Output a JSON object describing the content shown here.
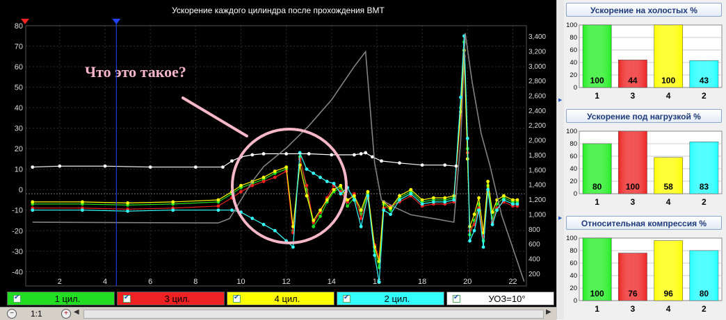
{
  "main": {
    "title": "Ускорение каждого цилиндра после прохождения ВМТ",
    "annotation": "Что это такое?"
  },
  "chart_data": {
    "type": "line",
    "xlim": [
      0.5,
      22.6
    ],
    "ylim": [
      -47,
      80
    ],
    "y2lim": [
      40,
      3550
    ],
    "x_ticks": [
      2,
      4,
      6,
      8,
      10,
      12,
      14,
      16,
      18,
      20,
      22
    ],
    "y_ticks": [
      -40,
      -30,
      -20,
      -10,
      0,
      10,
      20,
      30,
      40,
      50,
      60,
      70,
      80
    ],
    "y2_ticks": [
      "200",
      "400",
      "600",
      "800",
      "1,000",
      "1,200",
      "1,400",
      "1,600",
      "1,800",
      "2,000",
      "2,200",
      "2,400",
      "2,600",
      "2,800",
      "3,000",
      "3,200",
      "3,400"
    ],
    "y2_tick_values": [
      200,
      400,
      600,
      800,
      1000,
      1200,
      1400,
      1600,
      1800,
      2000,
      2200,
      2400,
      2600,
      2800,
      3000,
      3200,
      3400
    ],
    "cursor_x": 4.5,
    "grid": true,
    "series": [
      {
        "name": "1 цил.",
        "color": "#22dd22",
        "points": [
          [
            0.8,
            -7
          ],
          [
            3,
            -7
          ],
          [
            5,
            -7.5
          ],
          [
            7,
            -7
          ],
          [
            9,
            -6
          ],
          [
            9.6,
            -2
          ],
          [
            10,
            1
          ],
          [
            10.5,
            3
          ],
          [
            11,
            5
          ],
          [
            11.5,
            8
          ],
          [
            12,
            10
          ],
          [
            12.3,
            -20
          ],
          [
            12.6,
            16
          ],
          [
            12.9,
            0
          ],
          [
            13.2,
            -18
          ],
          [
            13.5,
            -13
          ],
          [
            13.8,
            -6
          ],
          [
            14.1,
            -1
          ],
          [
            14.4,
            1
          ],
          [
            14.7,
            -8
          ],
          [
            15,
            -4
          ],
          [
            15.3,
            -12
          ],
          [
            15.6,
            -2
          ],
          [
            15.9,
            -30
          ],
          [
            16.1,
            -38
          ],
          [
            16.3,
            -7
          ],
          [
            16.6,
            -10
          ],
          [
            17,
            -4
          ],
          [
            17.5,
            -1
          ],
          [
            18,
            -6
          ],
          [
            18.5,
            -5
          ],
          [
            19,
            -5
          ],
          [
            19.4,
            -4
          ],
          [
            19.7,
            40
          ],
          [
            19.85,
            72
          ],
          [
            20,
            20
          ],
          [
            20.1,
            -22
          ],
          [
            20.3,
            -15
          ],
          [
            20.5,
            -7
          ],
          [
            20.7,
            -25
          ],
          [
            20.9,
            2
          ],
          [
            21.1,
            -14
          ],
          [
            21.3,
            -7
          ],
          [
            21.6,
            -4
          ],
          [
            22,
            -6
          ],
          [
            22.2,
            -6
          ]
        ]
      },
      {
        "name": "3 цил.",
        "color": "#ee2222",
        "points": [
          [
            0.8,
            -9
          ],
          [
            3,
            -9
          ],
          [
            5,
            -9.5
          ],
          [
            7,
            -9
          ],
          [
            9,
            -8
          ],
          [
            9.6,
            -4
          ],
          [
            10,
            -1
          ],
          [
            10.5,
            2
          ],
          [
            11,
            4
          ],
          [
            11.5,
            6
          ],
          [
            12,
            9
          ],
          [
            12.3,
            -21
          ],
          [
            12.6,
            15
          ],
          [
            12.9,
            2
          ],
          [
            13.2,
            -16
          ],
          [
            13.5,
            -11
          ],
          [
            13.8,
            -4
          ],
          [
            14.1,
            2
          ],
          [
            14.4,
            -1
          ],
          [
            14.7,
            -6
          ],
          [
            15,
            -2
          ],
          [
            15.3,
            -14
          ],
          [
            15.6,
            -4
          ],
          [
            15.9,
            -27
          ],
          [
            16.1,
            -33
          ],
          [
            16.3,
            -9
          ],
          [
            16.6,
            -8
          ],
          [
            17,
            -6
          ],
          [
            17.5,
            -3
          ],
          [
            18,
            -8
          ],
          [
            18.5,
            -7
          ],
          [
            19,
            -7
          ],
          [
            19.4,
            -6
          ],
          [
            19.7,
            36
          ],
          [
            19.85,
            65
          ],
          [
            20,
            18
          ],
          [
            20.1,
            -20
          ],
          [
            20.3,
            -17
          ],
          [
            20.5,
            -9
          ],
          [
            20.7,
            -23
          ],
          [
            20.9,
            -1
          ],
          [
            21.1,
            -16
          ],
          [
            21.3,
            -9
          ],
          [
            21.6,
            -6
          ],
          [
            22,
            -8
          ],
          [
            22.2,
            -8
          ]
        ]
      },
      {
        "name": "4 цил.",
        "color": "#ffff00",
        "points": [
          [
            0.8,
            -6
          ],
          [
            3,
            -6
          ],
          [
            5,
            -6.5
          ],
          [
            7,
            -6
          ],
          [
            9,
            -5
          ],
          [
            9.6,
            -1
          ],
          [
            10,
            2
          ],
          [
            10.5,
            4
          ],
          [
            11,
            6
          ],
          [
            11.5,
            9
          ],
          [
            12,
            11
          ],
          [
            12.3,
            -18
          ],
          [
            12.6,
            12
          ],
          [
            12.9,
            -3
          ],
          [
            13.2,
            -15
          ],
          [
            13.5,
            -10
          ],
          [
            13.8,
            -5
          ],
          [
            14.1,
            0
          ],
          [
            14.4,
            2
          ],
          [
            14.7,
            -5
          ],
          [
            15,
            -3
          ],
          [
            15.3,
            -10
          ],
          [
            15.6,
            -1
          ],
          [
            15.9,
            -28
          ],
          [
            16.1,
            -35
          ],
          [
            16.3,
            -6
          ],
          [
            16.6,
            -9
          ],
          [
            17,
            -3
          ],
          [
            17.5,
            0
          ],
          [
            18,
            -5
          ],
          [
            18.5,
            -4
          ],
          [
            19,
            -4
          ],
          [
            19.4,
            -3
          ],
          [
            19.7,
            38
          ],
          [
            19.85,
            68
          ],
          [
            20,
            15
          ],
          [
            20.1,
            -18
          ],
          [
            20.3,
            -12
          ],
          [
            20.5,
            -4
          ],
          [
            20.7,
            -21
          ],
          [
            20.9,
            4
          ],
          [
            21.1,
            -11
          ],
          [
            21.3,
            -5
          ],
          [
            21.6,
            -3
          ],
          [
            22,
            -5
          ],
          [
            22.2,
            -5
          ]
        ]
      },
      {
        "name": "2 цил.",
        "color": "#33ffff",
        "points": [
          [
            0.8,
            -10
          ],
          [
            3,
            -10
          ],
          [
            5,
            -10.5
          ],
          [
            7,
            -10
          ],
          [
            9,
            -10
          ],
          [
            9.6,
            -10
          ],
          [
            10,
            -11
          ],
          [
            10.5,
            -14
          ],
          [
            11,
            -17
          ],
          [
            11.5,
            -20
          ],
          [
            12,
            -25
          ],
          [
            12.3,
            -28
          ],
          [
            12.6,
            18
          ],
          [
            12.9,
            10
          ],
          [
            13.2,
            8
          ],
          [
            13.5,
            6
          ],
          [
            13.8,
            4
          ],
          [
            14.1,
            3
          ],
          [
            14.4,
            -2
          ],
          [
            14.7,
            1
          ],
          [
            15,
            -5
          ],
          [
            15.3,
            -18
          ],
          [
            15.6,
            -3
          ],
          [
            15.9,
            -32
          ],
          [
            16.1,
            -45
          ],
          [
            16.3,
            -10
          ],
          [
            16.6,
            -12
          ],
          [
            17,
            -5
          ],
          [
            17.5,
            -2
          ],
          [
            18,
            -7
          ],
          [
            18.5,
            -6
          ],
          [
            19,
            -6
          ],
          [
            19.4,
            -5
          ],
          [
            19.7,
            45
          ],
          [
            19.85,
            75
          ],
          [
            20,
            25
          ],
          [
            20.1,
            -25
          ],
          [
            20.3,
            -20
          ],
          [
            20.5,
            -10
          ],
          [
            20.7,
            -28
          ],
          [
            20.9,
            0
          ],
          [
            21.1,
            -17
          ],
          [
            21.3,
            -10
          ],
          [
            21.6,
            -5
          ],
          [
            22,
            -7
          ],
          [
            22.2,
            -7
          ]
        ]
      },
      {
        "name": "УОЗ=10°",
        "color": "#ffffff",
        "points": [
          [
            0.8,
            11
          ],
          [
            2,
            11.5
          ],
          [
            4,
            11.5
          ],
          [
            6,
            11
          ],
          [
            8,
            11
          ],
          [
            9.2,
            11
          ],
          [
            9.6,
            14
          ],
          [
            10,
            16
          ],
          [
            10.5,
            17
          ],
          [
            11,
            17.5
          ],
          [
            12,
            17.5
          ],
          [
            13,
            17.5
          ],
          [
            14,
            17
          ],
          [
            15,
            17
          ],
          [
            15.3,
            17.5
          ],
          [
            15.5,
            18
          ],
          [
            15.8,
            16
          ],
          [
            16.2,
            14
          ],
          [
            17,
            13
          ],
          [
            18,
            12
          ],
          [
            19,
            12
          ],
          [
            19.5,
            11.5
          ]
        ]
      },
      {
        "name": "",
        "color": "#909090",
        "axis": "y2",
        "points": [
          [
            0.8,
            900
          ],
          [
            5,
            895
          ],
          [
            9,
            890
          ],
          [
            9.5,
            950
          ],
          [
            10,
            1200
          ],
          [
            10.5,
            1450
          ],
          [
            11,
            1650
          ],
          [
            12,
            1900
          ],
          [
            13,
            2200
          ],
          [
            14,
            2550
          ],
          [
            15,
            3000
          ],
          [
            15.5,
            3200
          ],
          [
            15.9,
            1700
          ],
          [
            16.2,
            1200
          ],
          [
            16.8,
            1100
          ],
          [
            17.5,
            1000
          ],
          [
            18.5,
            950
          ],
          [
            19.4,
            900
          ],
          [
            19.7,
            2000
          ],
          [
            19.9,
            3450
          ],
          [
            20.2,
            2800
          ],
          [
            20.6,
            2100
          ],
          [
            21,
            1650
          ],
          [
            21.5,
            1000
          ],
          [
            22,
            550
          ],
          [
            22.5,
            100
          ]
        ]
      }
    ]
  },
  "legend": [
    {
      "label": "1 цил.",
      "bg": "#22dd22"
    },
    {
      "label": "3 цил.",
      "bg": "#ee2222"
    },
    {
      "label": "4 цил.",
      "bg": "#ffff00"
    },
    {
      "label": "2 цил.",
      "bg": "#33ffff"
    },
    {
      "label": "УОЗ=10°",
      "bg": "#ffffff"
    }
  ],
  "status": {
    "zoom": "1:1"
  },
  "panels": [
    {
      "title": "Ускорение на холостых %",
      "ticks": [
        0,
        20,
        40,
        60,
        80,
        100
      ],
      "bars": [
        {
          "label": "1",
          "value": 100,
          "color": "#22ee22"
        },
        {
          "label": "3",
          "value": 44,
          "color": "#ee2222"
        },
        {
          "label": "4",
          "value": 100,
          "color": "#ffff00"
        },
        {
          "label": "2",
          "value": 43,
          "color": "#22ffff"
        }
      ]
    },
    {
      "title": "Ускорение под нагрузкой %",
      "ticks": [
        0,
        20,
        40,
        60,
        80,
        100
      ],
      "bars": [
        {
          "label": "1",
          "value": 80,
          "color": "#22ee22"
        },
        {
          "label": "3",
          "value": 100,
          "color": "#ee2222"
        },
        {
          "label": "4",
          "value": 58,
          "color": "#ffff00"
        },
        {
          "label": "2",
          "value": 83,
          "color": "#22ffff"
        }
      ]
    },
    {
      "title": "Относительная компрессия %",
      "ticks": [
        0,
        20,
        40,
        60,
        80,
        100
      ],
      "bars": [
        {
          "label": "1",
          "value": 100,
          "color": "#22ee22"
        },
        {
          "label": "3",
          "value": 76,
          "color": "#ee2222"
        },
        {
          "label": "4",
          "value": 96,
          "color": "#ffff00"
        },
        {
          "label": "2",
          "value": 80,
          "color": "#22ffff"
        }
      ]
    }
  ]
}
